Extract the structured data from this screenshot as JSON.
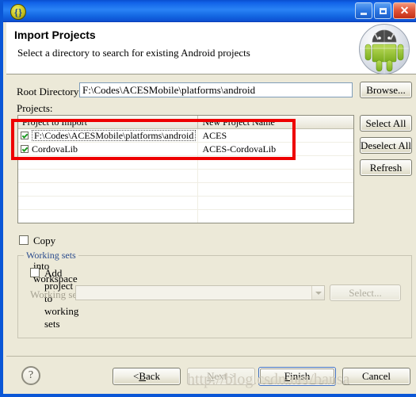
{
  "window": {
    "title": "",
    "icon": "eclipse-icon",
    "controls": {
      "minimize": "minimize-button",
      "maximize": "maximize-button",
      "close": "close-button",
      "close_glyph": "✕"
    }
  },
  "header": {
    "title": "Import Projects",
    "description": "Select a directory to search for existing Android projects",
    "logo": "android-robot-logo"
  },
  "form": {
    "root_directory_label": "Root Directory:",
    "root_directory_value": "F:\\Codes\\ACESMobile\\platforms\\android",
    "root_directory_placeholder": "",
    "browse_label": "Browse...",
    "projects_label": "Projects:"
  },
  "table": {
    "columns": [
      "Project to Import",
      "New Project Name"
    ],
    "rows": [
      {
        "checked": true,
        "project": "F:\\Codes\\ACESMobile\\platforms\\android",
        "new_name": "ACES"
      },
      {
        "checked": true,
        "project": "CordovaLib",
        "new_name": "ACES-CordovaLib"
      }
    ],
    "empty_rows": 6
  },
  "side_buttons": {
    "select_all": "Select All",
    "deselect_all": "Deselect All",
    "refresh": "Refresh"
  },
  "options": {
    "copy_projects_label": "Copy projects into workspace",
    "copy_projects_checked": false,
    "working_sets_group_label": "Working sets",
    "add_project_label": "Add project to working sets",
    "add_project_checked": false,
    "working_sets_field_label": "Working sets:",
    "working_sets_value": "",
    "working_sets_select_label": "Select..."
  },
  "footer": {
    "help": "?",
    "back": "< Back",
    "next": "Next >",
    "finish": "Finish",
    "cancel": "Cancel"
  },
  "overlay": {
    "watermark": "http://blog.csdn.net/bansa",
    "annotation_color": "#ee0000"
  },
  "colors": {
    "titlebar": "#1569e4",
    "dialog_bg": "#ece9d8",
    "group_label": "#2a4b8d",
    "accent_red": "#ee0000"
  }
}
